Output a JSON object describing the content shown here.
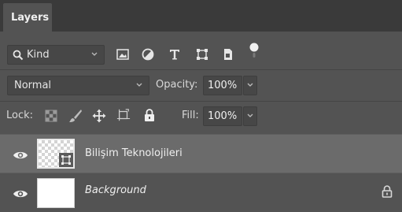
{
  "panel": {
    "tab_label": "Layers"
  },
  "filter": {
    "kind_label": "Kind",
    "filter_icons": [
      "image-filter-icon",
      "adjustment-filter-icon",
      "type-filter-icon",
      "shape-filter-icon",
      "smart-object-filter-icon",
      "filter-toggle-icon"
    ]
  },
  "blend": {
    "mode": "Normal",
    "opacity_label": "Opacity:",
    "opacity_value": "100%"
  },
  "lock": {
    "label": "Lock:",
    "icons": [
      "lock-transparent-pixels-icon",
      "lock-image-pixels-icon",
      "lock-position-icon",
      "lock-artboard-icon",
      "lock-all-icon"
    ],
    "fill_label": "Fill:",
    "fill_value": "100%"
  },
  "layers": [
    {
      "name": "Bilişim Teknolojileri",
      "visible": true,
      "selected": true,
      "smart_object": true
    },
    {
      "name": "Background",
      "visible": true,
      "selected": false,
      "locked": true
    }
  ],
  "colors": {
    "panel_bg": "#535353",
    "tabbar_bg": "#3a3a3a",
    "selected_row": "#6b6b6b"
  }
}
